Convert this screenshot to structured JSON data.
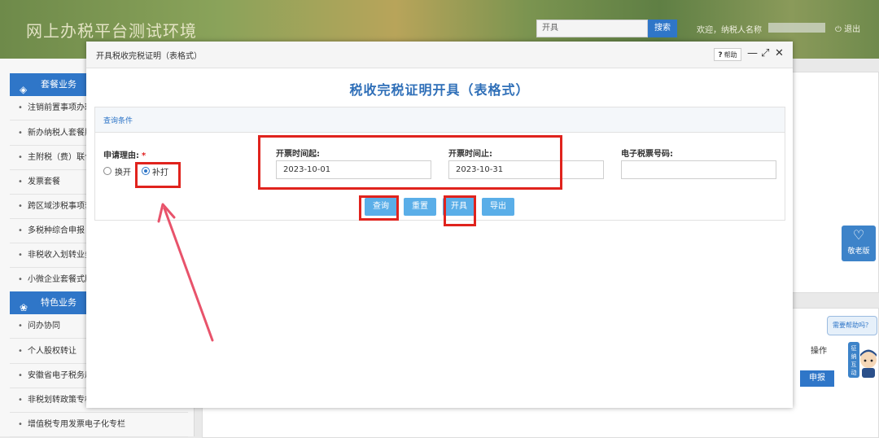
{
  "header": {
    "site_title": "网上办税平台测试环境",
    "search_value": "开具",
    "search_button": "搜索",
    "welcome": "欢迎，纳税人名称",
    "logout": "退出"
  },
  "sidebar": {
    "group1": "套餐业务",
    "group1_items": [
      "注销前置事项办理",
      "新办纳税人套餐服",
      "主附税（费）联合",
      "发票套餐",
      "跨区域涉税事项套",
      "多税种综合申报",
      "非税收入划转业务",
      "小微企业套餐式服"
    ],
    "group2": "特色业务",
    "group2_items": [
      "问办协同",
      "个人股权转让",
      "安徽省电子税务局",
      "非税划转政策专栏",
      "增值税专用发票电子化专栏"
    ]
  },
  "right": {
    "operation_label": "操作",
    "declare_button": "申报",
    "elder_mode": "敬老版",
    "help_bubble": "需要帮助吗？",
    "mascot_text": "征纳互动"
  },
  "modal": {
    "title": "开具税收完税证明（表格式）",
    "help": "帮助",
    "heading": "税收完税证明开具（表格式）",
    "panel_title": "查询条件",
    "reason_label": "申请理由:",
    "reason_options": [
      "换开",
      "补打"
    ],
    "reason_selected": "补打",
    "start_label": "开票时间起:",
    "start_value": "2023-10-01",
    "end_label": "开票时间止:",
    "end_value": "2023-10-31",
    "ticket_label": "电子税票号码:",
    "ticket_value": "",
    "buttons": {
      "query": "查询",
      "reset": "重置",
      "issue": "开具",
      "export": "导出"
    }
  },
  "colors": {
    "primary": "#2f76c8",
    "button": "#5aaee8",
    "highlight": "#e0231d",
    "arrow": "#e8536b"
  }
}
